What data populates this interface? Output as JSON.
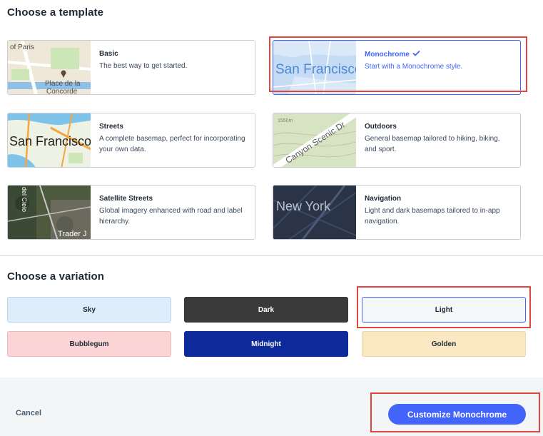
{
  "template_section": {
    "heading": "Choose a template",
    "templates": [
      {
        "title": "Basic",
        "description": "The best way to get started.",
        "thumb_text_1": "of Paris",
        "thumb_text_2": "Place de la",
        "thumb_text_3": "Concorde",
        "selected": false
      },
      {
        "title": "Monochrome",
        "description": "Start with a Monochrome style.",
        "thumb_text_1": "San Francisco",
        "selected": true,
        "icon": "checkmark-icon"
      },
      {
        "title": "Streets",
        "description": "A complete basemap, perfect for incorporating your own data.",
        "thumb_text_1": "San Francisco",
        "selected": false
      },
      {
        "title": "Outdoors",
        "description": "General basemap tailored to hiking, biking, and sport.",
        "thumb_text_1": "Canyon Scenic Dr",
        "thumb_text_2": "1550m",
        "selected": false
      },
      {
        "title": "Satellite Streets",
        "description": "Global imagery enhanced with road and label hierarchy.",
        "thumb_text_1": "Trader J",
        "thumb_text_2": "del Cielo",
        "selected": false
      },
      {
        "title": "Navigation",
        "description": "Light and dark basemaps tailored to in-app navigation.",
        "thumb_text_1": "New York",
        "selected": false
      }
    ]
  },
  "variation_section": {
    "heading": "Choose a variation",
    "variations": [
      {
        "label": "Sky",
        "bg": "#dfedfb",
        "border": "#b7d3ef",
        "color": "#1f2a37",
        "selected": false
      },
      {
        "label": "Dark",
        "bg": "#3a3a3a",
        "border": "#3a3a3a",
        "color": "#ffffff",
        "selected": false
      },
      {
        "label": "Light",
        "bg": "#f4f6f8",
        "border": "#4264fb",
        "color": "#1f2a37",
        "selected": true
      },
      {
        "label": "Bubblegum",
        "bg": "#fbd5d5",
        "border": "#f0b6b6",
        "color": "#1f2a37",
        "selected": false
      },
      {
        "label": "Midnight",
        "bg": "#0e2a9a",
        "border": "#0e2a9a",
        "color": "#ffffff",
        "selected": false
      },
      {
        "label": "Golden",
        "bg": "#f9e8c2",
        "border": "#eed8a8",
        "color": "#1f2a37",
        "selected": false
      }
    ]
  },
  "footer": {
    "cancel_label": "Cancel",
    "primary_label": "Customize Monochrome"
  },
  "colors": {
    "accent": "#4264fb",
    "highlight": "#e0453f"
  }
}
